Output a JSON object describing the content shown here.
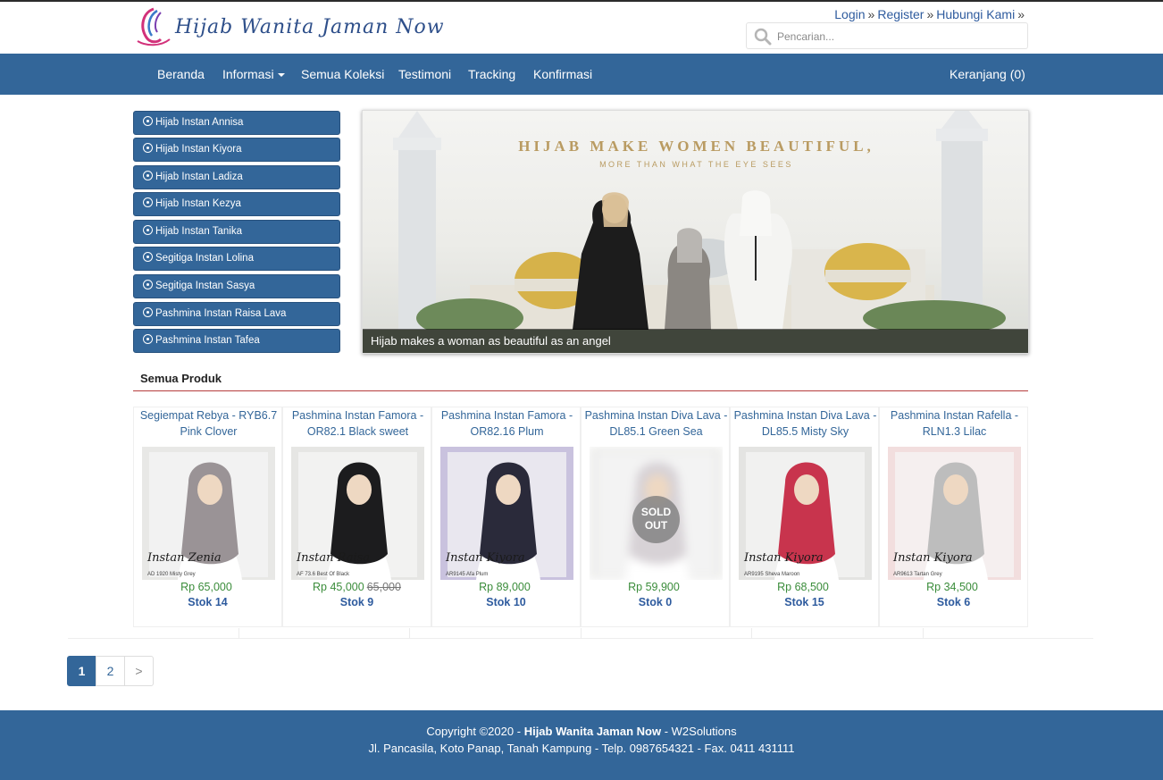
{
  "brand": {
    "logo_text": "Hijab Wanita Jaman Now"
  },
  "top_links": [
    {
      "label": "Login",
      "sep": "»"
    },
    {
      "label": "Register",
      "sep": "»"
    },
    {
      "label": "Hubungi Kami",
      "sep": "»"
    }
  ],
  "search": {
    "placeholder": "Pencarian..."
  },
  "nav": {
    "items": [
      "Beranda",
      "Informasi",
      "Semua Koleksi",
      "Testimoni",
      "Tracking",
      "Konfirmasi"
    ],
    "cart": "Keranjang (0)"
  },
  "sidebar": {
    "items": [
      "Hijab Instan Annisa",
      "Hijab Instan Kiyora",
      "Hijab Instan Ladiza",
      "Hijab Instan Kezya",
      "Hijab Instan Tanika",
      "Segitiga Instan Lolina",
      "Segitiga Instan Sasya",
      "Pashmina Instan Raisa Lava",
      "Pashmina Instan Tafea"
    ]
  },
  "banner": {
    "headline": "HIJAB MAKE WOMEN BEAUTIFUL,",
    "subline": "MORE THAN WHAT THE EYE SEES",
    "caption": "Hijab makes a woman as beautiful as an angel"
  },
  "section": {
    "title": "Semua Produk"
  },
  "products": [
    {
      "name": "Segiempat Rebya - RYB6.7 Pink Clover",
      "price": "Rp 65,000",
      "old_price": "",
      "stock": "Stok 14",
      "img_script": "Instan Zenia",
      "img_code": "AD 1920 Misty Grey",
      "scarf_color": "#9a9396",
      "bg_color": "#e8e8e6",
      "sold_out": ""
    },
    {
      "name": "Pashmina Instan Famora - OR82.1 Black sweet",
      "price": "Rp 45,000",
      "old_price": "65,000",
      "stock": "Stok 9",
      "img_script": "Instan Raisa",
      "img_code": "AF 73.6 Best Of Black",
      "scarf_color": "#1c1c1e",
      "bg_color": "#e6e6e4",
      "sold_out": ""
    },
    {
      "name": "Pashmina Instan Famora - OR82.16 Plum",
      "price": "Rp 89,000",
      "old_price": "",
      "stock": "Stok 10",
      "img_script": "Instan Kiyora",
      "img_code": "AR9145 Afa Plum",
      "scarf_color": "#2a2a3a",
      "bg_color": "#c9c2de",
      "sold_out": ""
    },
    {
      "name": "Pashmina Instan Diva Lava - DL85.1 Green Sea",
      "price": "Rp 59,900",
      "old_price": "",
      "stock": "Stok 0",
      "img_script": "",
      "img_code": "",
      "scarf_color": "#d7d2d6",
      "bg_color": "#ececea",
      "sold_out": "SOLD OUT"
    },
    {
      "name": "Pashmina Instan Diva Lava - DL85.5 Misty Sky",
      "price": "Rp 68,500",
      "old_price": "",
      "stock": "Stok 15",
      "img_script": "Instan Kiyora",
      "img_code": "AR9195 Sheva Maroon",
      "scarf_color": "#c8344d",
      "bg_color": "#e4e4e2",
      "sold_out": ""
    },
    {
      "name": "Pashmina Instan Rafella - RLN1.3 Lilac",
      "price": "Rp 34,500",
      "old_price": "",
      "stock": "Stok 6",
      "img_script": "Instan Kiyora",
      "img_code": "AR9613 Tartan Grey",
      "scarf_color": "#bdbdbd",
      "bg_color": "#f2dede",
      "sold_out": ""
    }
  ],
  "pagination": {
    "pages": [
      "1",
      "2",
      ">"
    ]
  },
  "footer": {
    "prefix": "Copyright ©2020 -",
    "brand": "Hijab Wanita Jaman Now",
    "suffix": "- W2Solutions",
    "address": "Jl. Pancasila, Koto Panap, Tanah Kampung - Telp. 0987654321 - Fax. 0411 431111"
  },
  "colors": {
    "primary": "#336699",
    "price_green": "#3a8c3a",
    "section_rule": "#b53c3c"
  }
}
